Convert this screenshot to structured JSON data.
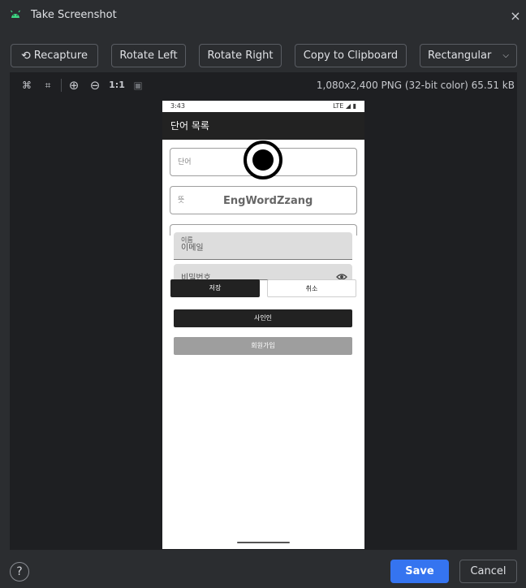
{
  "window": {
    "title": "Take Screenshot",
    "close_icon": "×"
  },
  "toolbar": {
    "recapture_icon": "⟲",
    "recapture": "Recapture",
    "rotate_left": "Rotate Left",
    "rotate_right": "Rotate Right",
    "copy": "Copy to Clipboard",
    "mode_selected": "Rectangular",
    "mode_chevron": "⌵"
  },
  "canvas_tools": {
    "fit_icon": "⌘",
    "crop_icon": "⌗",
    "zoom_in_icon": "⊕",
    "zoom_out_icon": "⊖",
    "actual_size": "1:1",
    "frame_icon": "▣",
    "image_info": "1,080x2,400 PNG (32-bit color) 65.51 kB"
  },
  "phone": {
    "status": {
      "time": "3:43",
      "right": "LTE ◢ ▮"
    },
    "appbar_title": "단어 목록",
    "word_label": "단어",
    "meaning_label": "뜻",
    "overlay_text": "EngWordZzang",
    "email_label": "이름",
    "email_value": "이메일",
    "password_value": "비밀번호",
    "save": "저장",
    "cancel": "취소",
    "signin": "사인인",
    "signup": "회원가입"
  },
  "footer": {
    "help": "?",
    "save": "Save",
    "cancel": "Cancel"
  },
  "colors": {
    "background": "#2b2d30",
    "canvas": "#1e1f22",
    "primary": "#3574f0",
    "android_green": "#3ddc84"
  }
}
